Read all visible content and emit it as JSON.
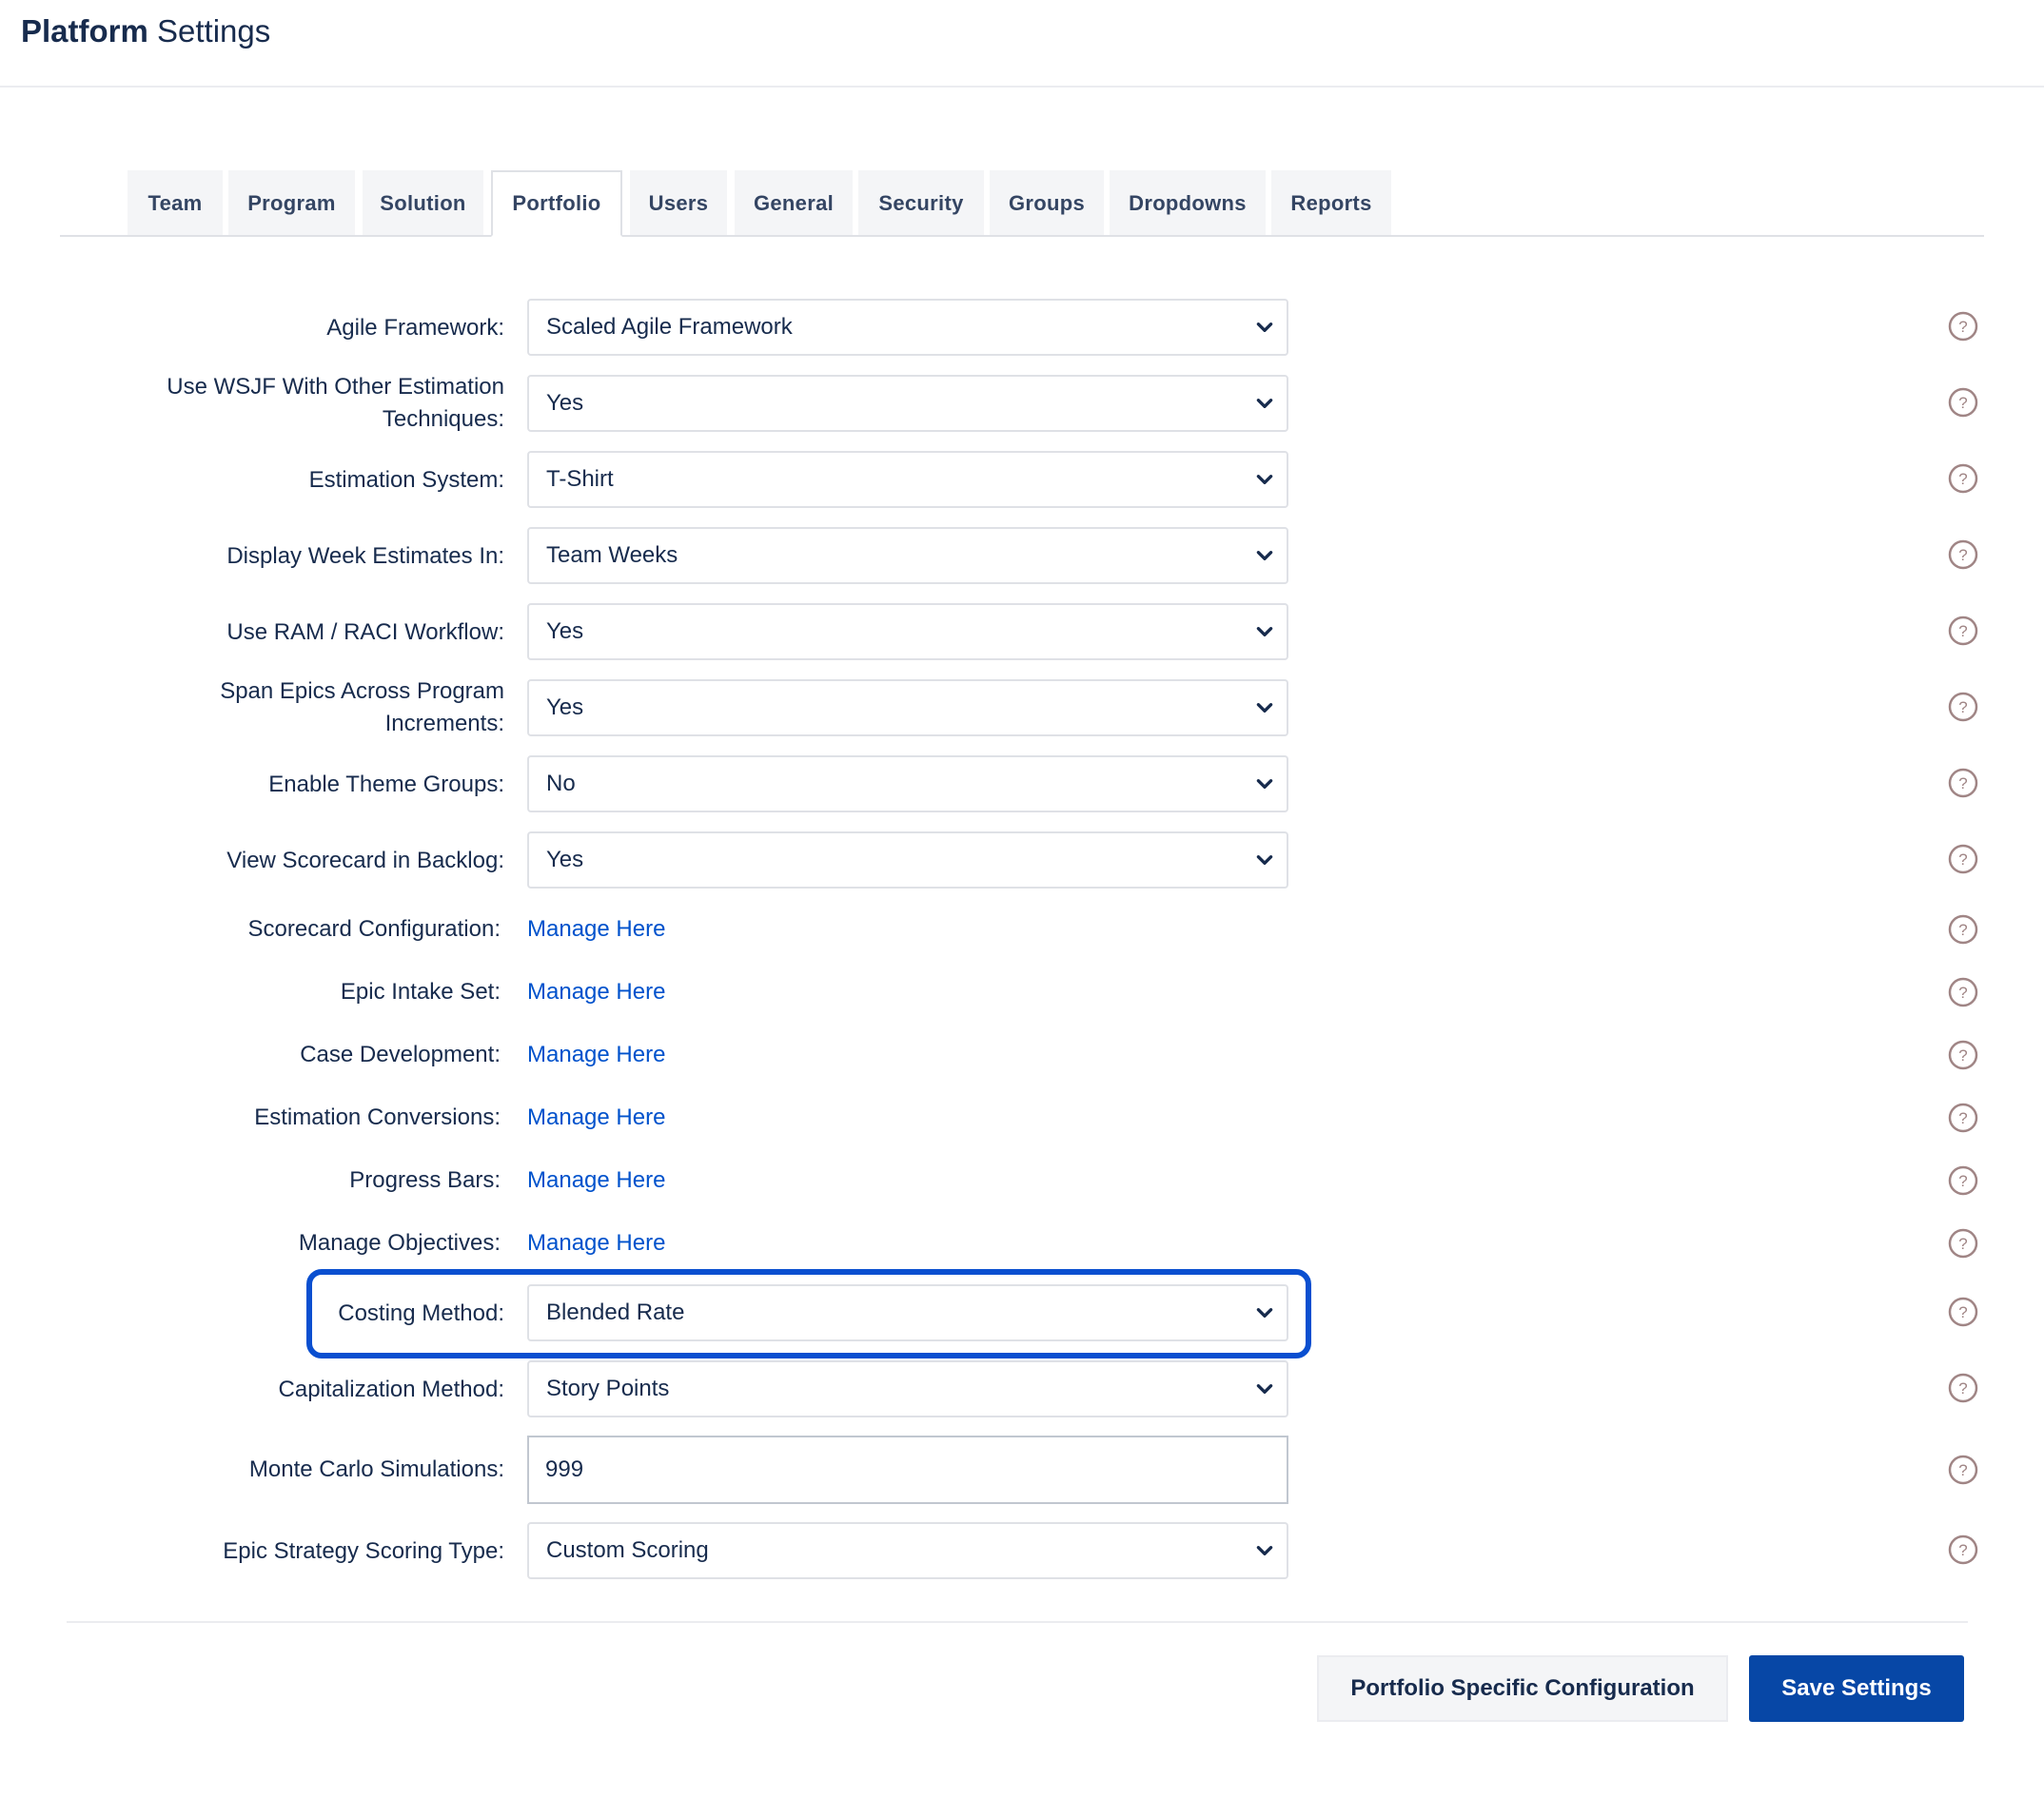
{
  "header": {
    "title_bold": "Platform",
    "title_rest": " Settings"
  },
  "tabs": [
    {
      "label": "Team"
    },
    {
      "label": "Program"
    },
    {
      "label": "Solution"
    },
    {
      "label": "Portfolio"
    },
    {
      "label": "Users"
    },
    {
      "label": "General"
    },
    {
      "label": "Security"
    },
    {
      "label": "Groups"
    },
    {
      "label": "Dropdowns"
    },
    {
      "label": "Reports"
    }
  ],
  "active_tab": "Portfolio",
  "settings": {
    "agile_framework": {
      "label": "Agile Framework:",
      "value": "Scaled Agile Framework"
    },
    "use_wsjf": {
      "label_line1": "Use WSJF With Other Estimation",
      "label_line2": "Techniques:",
      "value": "Yes"
    },
    "estimation_system": {
      "label": "Estimation System:",
      "value": "T-Shirt"
    },
    "display_week_estimates": {
      "label": "Display Week Estimates In:",
      "value": "Team Weeks"
    },
    "ram_raci": {
      "label": "Use RAM / RACI Workflow:",
      "value": "Yes"
    },
    "span_epics": {
      "label_line1": "Span Epics Across Program",
      "label_line2": "Increments:",
      "value": "Yes"
    },
    "theme_groups": {
      "label": "Enable Theme Groups:",
      "value": "No"
    },
    "scorecard_backlog": {
      "label": "View Scorecard in Backlog:",
      "value": "Yes"
    },
    "scorecard_config": {
      "label": "Scorecard Configuration:",
      "link": "Manage Here"
    },
    "epic_intake": {
      "label": "Epic Intake Set:",
      "link": "Manage Here"
    },
    "case_development": {
      "label": "Case Development:",
      "link": "Manage Here"
    },
    "estimation_conversions": {
      "label": "Estimation Conversions:",
      "link": "Manage Here"
    },
    "progress_bars": {
      "label": "Progress Bars:",
      "link": "Manage Here"
    },
    "manage_objectives": {
      "label": "Manage Objectives:",
      "link": "Manage Here"
    },
    "costing_method": {
      "label": "Costing Method:",
      "value": "Blended Rate"
    },
    "capitalization_method": {
      "label": "Capitalization Method:",
      "value": "Story Points"
    },
    "monte_carlo": {
      "label": "Monte Carlo Simulations:",
      "value": "999"
    },
    "epic_strategy_scoring": {
      "label": "Epic Strategy Scoring Type:",
      "value": "Custom Scoring"
    }
  },
  "buttons": {
    "portfolio_config": "Portfolio Specific Configuration",
    "save": "Save Settings"
  },
  "colors": {
    "accent": "#0747a6",
    "link": "#0052cc",
    "highlight": "#0a4fd0",
    "help_icon": "#a08585"
  }
}
